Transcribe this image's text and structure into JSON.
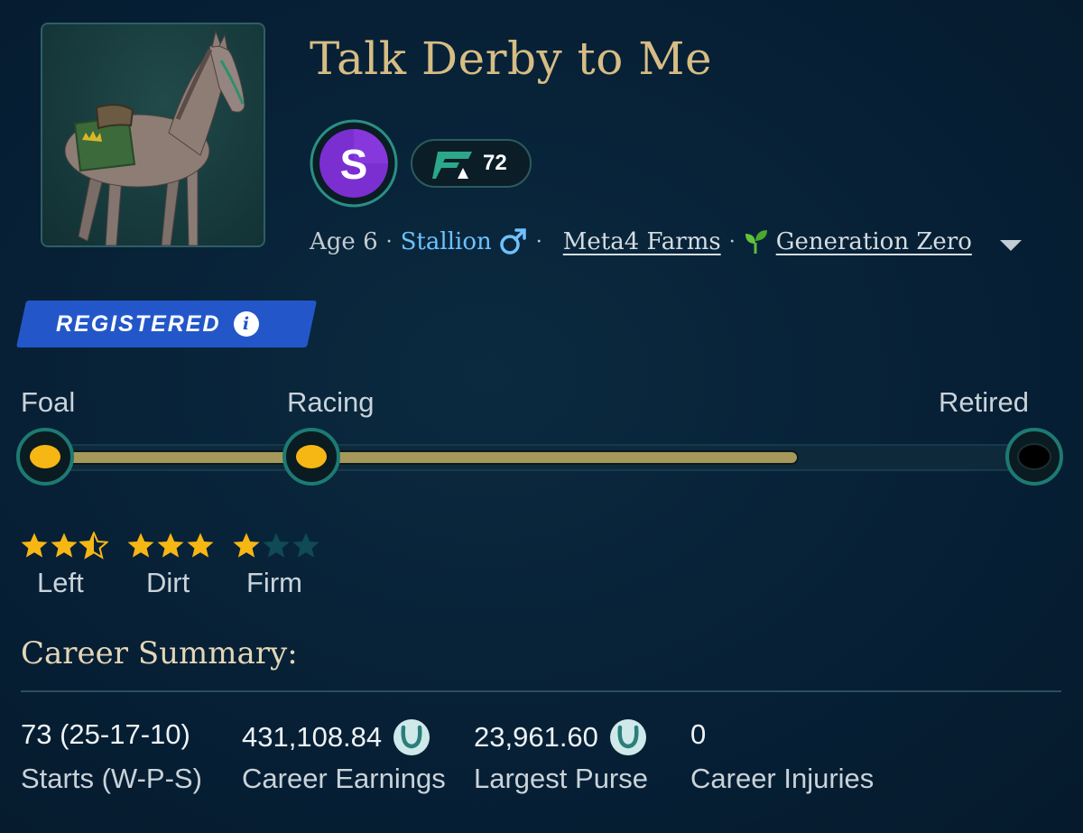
{
  "horse": {
    "name": "Talk Derby to Me",
    "class_letter": "S",
    "rating": "72",
    "age": "Age 6",
    "sex": "Stallion",
    "stable": "Meta4 Farms",
    "generation": "Generation Zero"
  },
  "registration": {
    "label": "REGISTERED",
    "info_glyph": "i"
  },
  "lifecycle": {
    "stages": [
      "Foal",
      "Racing",
      "Retired"
    ],
    "current_stage": "Racing",
    "progress_fraction": 0.75
  },
  "surface_ratings": [
    {
      "label": "Left",
      "stars": 2.5,
      "max": 3
    },
    {
      "label": "Dirt",
      "stars": 3,
      "max": 3
    },
    {
      "label": "Firm",
      "stars": 1,
      "max": 3
    }
  ],
  "career": {
    "title": "Career Summary:",
    "stats": [
      {
        "value": "73 (25-17-10)",
        "label": "Starts (W-P-S)",
        "currency_icon": false
      },
      {
        "value": "431,108.84",
        "label": "Career Earnings",
        "currency_icon": true
      },
      {
        "value": "23,961.60",
        "label": "Largest Purse",
        "currency_icon": true
      },
      {
        "value": "0",
        "label": "Career Injuries",
        "currency_icon": false
      }
    ]
  },
  "colors": {
    "background": "#072036",
    "gold_text": "#d6bd84",
    "registered_blue": "#2357c9",
    "star_gold": "#f6b614",
    "star_empty": "#0f4a55",
    "link_blue": "#6ec1ff",
    "class_purple": "#7b2fd0",
    "node_teal": "#1d7a72"
  },
  "icons": [
    "horse-portrait",
    "class-s-icon",
    "rating-logo-icon",
    "male-icon",
    "sprout-icon",
    "caret-down-icon",
    "info-icon",
    "star-icon",
    "horseshoe-icon"
  ]
}
